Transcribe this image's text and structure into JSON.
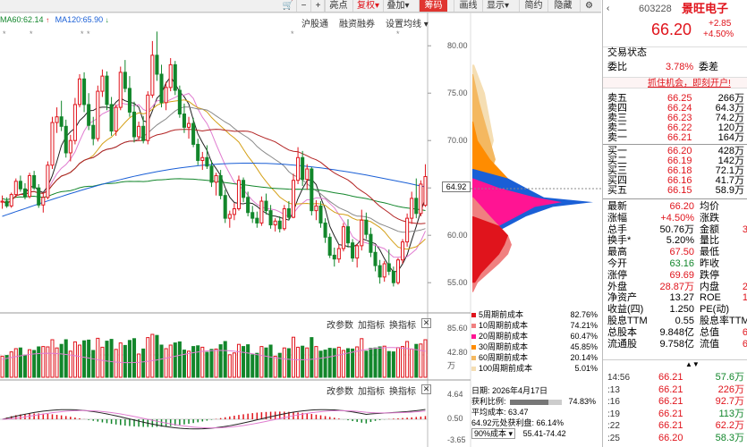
{
  "toolbar": {
    "icons": [
      "cart-icon",
      "minus-icon",
      "plus-icon",
      "left-arrow-icon",
      "right-arrow-icon"
    ],
    "buttons": [
      "亮点",
      "复权",
      "叠加",
      "筹码",
      "画线",
      "显示",
      "简约",
      "隐藏"
    ],
    "dropdown_marks": [
      "▾",
      "▾",
      "▾",
      "▾",
      "▾"
    ]
  },
  "legend": {
    "ma60": "MA60:62.14",
    "ma120": "MA120:65.90"
  },
  "chart_menu": {
    "hgt": "沪股通",
    "margin": "融资融券",
    "setting": "设置均线"
  },
  "price_axis": [
    "80.00",
    "75.00",
    "70.00",
    "65.00",
    "60.00",
    "55.00"
  ],
  "current_price_tag": "64.92",
  "volume_axis": [
    "85.60",
    "42.80",
    "万"
  ],
  "indicator_axis": [
    "4.64",
    "0.50",
    "-3.65"
  ],
  "subchart_menu": {
    "params": "改参数",
    "add": "加指标",
    "switch": "换指标"
  },
  "cost_legend": [
    {
      "label": "5周期前成本",
      "value": "82.76%",
      "color": "#e0141c"
    },
    {
      "label": "10周期前成本",
      "value": "74.21%",
      "color": "#f08080"
    },
    {
      "label": "20周期前成本",
      "value": "60.47%",
      "color": "#ff1493"
    },
    {
      "label": "30周期前成本",
      "value": "45.85%",
      "color": "#ff8c00"
    },
    {
      "label": "60周期前成本",
      "value": "20.14%",
      "color": "#f4b860"
    },
    {
      "label": "100周期前成本",
      "value": "5.01%",
      "color": "#f5deb3"
    }
  ],
  "cost_info": {
    "date": "日期: 2026年4月17日",
    "profit_label": "获利比例:",
    "profit_value": "74.83%",
    "avg_cost": "平均成本: 63.47",
    "price_profit": "64.92元处获利盘: 66.14%",
    "cost_range_label": "90%成本",
    "cost_range": "55.41-74.42"
  },
  "quote": {
    "code": "603228",
    "name": "景旺电子",
    "price": "66.20",
    "change": "+2.85",
    "change_pct": "+4.50%",
    "status": "交易状态",
    "weibi_label": "委比",
    "weibi_value": "3.78%",
    "weicha_label": "委差",
    "promo": "抓住机会，即刻开户!",
    "asks": [
      {
        "label": "卖五",
        "price": "66.25",
        "vol": "266万"
      },
      {
        "label": "卖四",
        "price": "66.24",
        "vol": "64.3万"
      },
      {
        "label": "卖三",
        "price": "66.23",
        "vol": "74.2万"
      },
      {
        "label": "卖二",
        "price": "66.22",
        "vol": "120万"
      },
      {
        "label": "卖一",
        "price": "66.21",
        "vol": "164万"
      }
    ],
    "bids": [
      {
        "label": "买一",
        "price": "66.20",
        "vol": "428万"
      },
      {
        "label": "买二",
        "price": "66.19",
        "vol": "142万"
      },
      {
        "label": "买三",
        "price": "66.18",
        "vol": "72.1万"
      },
      {
        "label": "买四",
        "price": "66.16",
        "vol": "41.7万"
      },
      {
        "label": "买五",
        "price": "66.15",
        "vol": "58.9万"
      }
    ],
    "stats": [
      {
        "l1": "最新",
        "v1": "66.20",
        "c1": "red",
        "l2": "均价",
        "v2": ""
      },
      {
        "l1": "涨幅",
        "v1": "+4.50%",
        "c1": "red",
        "l2": "涨跌",
        "v2": ""
      },
      {
        "l1": "总手",
        "v1": "50.76万",
        "c1": "blk",
        "l2": "金额",
        "v2": "3"
      },
      {
        "l1": "换手*",
        "v1": "5.20%",
        "c1": "blk",
        "l2": "量比",
        "v2": ""
      },
      {
        "l1": "最高",
        "v1": "67.50",
        "c1": "red",
        "l2": "最低",
        "v2": ""
      },
      {
        "l1": "今开",
        "v1": "63.16",
        "c1": "grn",
        "l2": "昨收",
        "v2": ""
      },
      {
        "l1": "涨停",
        "v1": "69.69",
        "c1": "red",
        "l2": "跌停",
        "v2": ""
      },
      {
        "l1": "外盘",
        "v1": "28.87万",
        "c1": "red",
        "l2": "内盘",
        "v2": "2"
      },
      {
        "l1": "净资产",
        "v1": "13.27",
        "c1": "blk",
        "l2": "ROE",
        "v2": "1"
      },
      {
        "l1": "收益(四)",
        "v1": "1.250",
        "c1": "blk",
        "l2": "PE(动)",
        "v2": ""
      },
      {
        "l1": "股息TTM",
        "v1": "0.55",
        "c1": "blk",
        "l2": "股息率TTM",
        "v2": ""
      },
      {
        "l1": "总股本",
        "v1": "9.848亿",
        "c1": "blk",
        "l2": "总值",
        "v2": "6"
      },
      {
        "l1": "流通股",
        "v1": "9.758亿",
        "c1": "blk",
        "l2": "流值",
        "v2": "6"
      }
    ],
    "ticks": [
      {
        "time": "14:56",
        "price": "66.21",
        "vol": "57.6万",
        "vc": "grn"
      },
      {
        "time": ":13",
        "price": "66.21",
        "vol": "226万",
        "vc": "red"
      },
      {
        "time": ":16",
        "price": "66.21",
        "vol": "92.7万",
        "vc": "red"
      },
      {
        "time": ":19",
        "price": "66.21",
        "vol": "113万",
        "vc": "grn"
      },
      {
        "time": ":22",
        "price": "66.21",
        "vol": "62.2万",
        "vc": "red"
      },
      {
        "time": ":25",
        "price": "66.20",
        "vol": "58.3万",
        "vc": "grn"
      }
    ]
  },
  "chart_data": {
    "type": "candlestick",
    "ylim": [
      52,
      82
    ],
    "ohlc": [
      [
        63.5,
        64.2,
        62.8,
        63.6
      ],
      [
        63.6,
        64.0,
        62.9,
        63.1
      ],
      [
        63.1,
        64.5,
        62.9,
        64.3
      ],
      [
        64.3,
        66.0,
        64.0,
        65.7
      ],
      [
        65.7,
        66.3,
        64.6,
        64.9
      ],
      [
        64.9,
        65.5,
        63.8,
        64.1
      ],
      [
        64.1,
        66.6,
        63.9,
        66.3
      ],
      [
        66.3,
        66.8,
        64.8,
        65.0
      ],
      [
        65.0,
        65.4,
        62.9,
        63.2
      ],
      [
        63.2,
        64.5,
        62.4,
        64.0
      ],
      [
        64.0,
        67.8,
        63.8,
        67.4
      ],
      [
        67.4,
        72.5,
        67.0,
        71.9
      ],
      [
        71.9,
        73.5,
        70.8,
        72.5
      ],
      [
        72.5,
        74.2,
        71.0,
        71.5
      ],
      [
        71.5,
        72.2,
        68.2,
        68.7
      ],
      [
        68.7,
        70.6,
        67.8,
        70.0
      ],
      [
        70.0,
        74.5,
        69.6,
        73.8
      ],
      [
        73.8,
        77.0,
        73.5,
        76.5
      ],
      [
        76.5,
        77.2,
        73.0,
        73.8
      ],
      [
        73.8,
        75.0,
        71.1,
        71.6
      ],
      [
        71.6,
        72.5,
        69.5,
        70.2
      ],
      [
        70.2,
        75.8,
        69.9,
        75.2
      ],
      [
        75.2,
        77.5,
        74.6,
        76.8
      ],
      [
        76.8,
        77.3,
        73.2,
        73.8
      ],
      [
        73.8,
        74.6,
        70.5,
        71.0
      ],
      [
        71.0,
        73.8,
        70.5,
        73.5
      ],
      [
        73.5,
        77.8,
        73.2,
        77.2
      ],
      [
        77.2,
        78.5,
        75.1,
        75.5
      ],
      [
        75.5,
        76.8,
        72.5,
        73.0
      ],
      [
        73.0,
        74.1,
        69.8,
        70.4
      ],
      [
        70.4,
        72.0,
        70.0,
        71.5
      ],
      [
        71.5,
        72.6,
        69.7,
        70.0
      ],
      [
        70.0,
        75.2,
        69.6,
        74.8
      ],
      [
        74.8,
        80.5,
        74.5,
        79.0
      ],
      [
        79.0,
        81.5,
        76.3,
        77.0
      ],
      [
        77.0,
        78.0,
        73.5,
        74.0
      ],
      [
        74.0,
        76.2,
        73.2,
        75.6
      ],
      [
        75.6,
        78.7,
        75.2,
        78.0
      ],
      [
        78.0,
        78.4,
        74.8,
        75.3
      ],
      [
        75.3,
        75.8,
        72.4,
        72.8
      ],
      [
        72.8,
        73.9,
        70.8,
        71.4
      ],
      [
        71.4,
        72.5,
        70.2,
        71.8
      ],
      [
        71.8,
        72.4,
        69.3,
        69.6
      ],
      [
        69.6,
        70.2,
        67.4,
        67.9
      ],
      [
        67.9,
        68.8,
        66.9,
        68.2
      ],
      [
        68.2,
        69.5,
        67.0,
        67.3
      ],
      [
        67.3,
        67.9,
        65.1,
        65.6
      ],
      [
        65.6,
        66.6,
        64.2,
        66.3
      ],
      [
        66.3,
        66.9,
        63.8,
        64.2
      ],
      [
        64.2,
        64.8,
        61.3,
        61.8
      ],
      [
        61.8,
        62.6,
        60.8,
        62.2
      ],
      [
        62.2,
        63.4,
        61.6,
        62.8
      ],
      [
        62.8,
        66.3,
        62.6,
        65.8
      ],
      [
        65.8,
        66.1,
        63.5,
        64.0
      ],
      [
        64.0,
        64.6,
        62.0,
        62.4
      ],
      [
        62.4,
        63.1,
        61.3,
        61.8
      ],
      [
        61.8,
        62.5,
        60.8,
        61.3
      ],
      [
        61.3,
        64.1,
        61.0,
        63.6
      ],
      [
        63.6,
        64.4,
        62.2,
        62.6
      ],
      [
        62.6,
        63.2,
        60.7,
        61.1
      ],
      [
        61.1,
        61.8,
        60.4,
        61.5
      ],
      [
        61.5,
        62.0,
        60.3,
        60.7
      ],
      [
        60.7,
        63.2,
        60.5,
        62.8
      ],
      [
        62.8,
        63.6,
        61.6,
        61.9
      ],
      [
        61.9,
        66.5,
        61.8,
        65.8
      ],
      [
        65.8,
        69.3,
        65.4,
        68.2
      ],
      [
        68.2,
        68.9,
        65.2,
        65.9
      ],
      [
        65.9,
        67.5,
        64.8,
        67.0
      ],
      [
        67.0,
        67.2,
        62.1,
        62.6
      ],
      [
        62.6,
        63.7,
        61.6,
        63.1
      ],
      [
        63.1,
        63.6,
        60.8,
        61.3
      ],
      [
        61.3,
        61.8,
        59.2,
        59.8
      ],
      [
        59.8,
        60.2,
        57.6,
        57.9
      ],
      [
        57.9,
        58.7,
        56.7,
        57.5
      ],
      [
        57.5,
        59.0,
        57.1,
        58.6
      ],
      [
        58.6,
        61.3,
        58.3,
        60.9
      ],
      [
        60.9,
        61.7,
        58.7,
        59.2
      ],
      [
        59.2,
        59.6,
        57.2,
        57.6
      ],
      [
        57.6,
        59.1,
        56.6,
        58.9
      ],
      [
        58.9,
        62.7,
        58.4,
        61.6
      ],
      [
        61.6,
        62.4,
        59.6,
        60.1
      ],
      [
        60.1,
        60.8,
        57.7,
        58.2
      ],
      [
        58.2,
        58.9,
        56.2,
        56.8
      ],
      [
        56.8,
        57.4,
        54.9,
        55.6
      ],
      [
        55.6,
        57.3,
        55.1,
        57.0
      ],
      [
        57.0,
        58.5,
        55.8,
        56.2
      ],
      [
        56.2,
        56.7,
        54.6,
        55.0
      ],
      [
        55.0,
        57.6,
        54.8,
        57.4
      ],
      [
        57.4,
        59.6,
        57.0,
        59.3
      ],
      [
        59.3,
        62.3,
        58.8,
        61.8
      ],
      [
        61.8,
        64.6,
        61.2,
        63.9
      ],
      [
        63.9,
        66.0,
        61.8,
        62.3
      ],
      [
        62.3,
        65.8,
        62.0,
        65.4
      ],
      [
        63.16,
        67.5,
        63.0,
        66.2
      ]
    ],
    "ma60": 62.14,
    "ma120": 65.9
  }
}
